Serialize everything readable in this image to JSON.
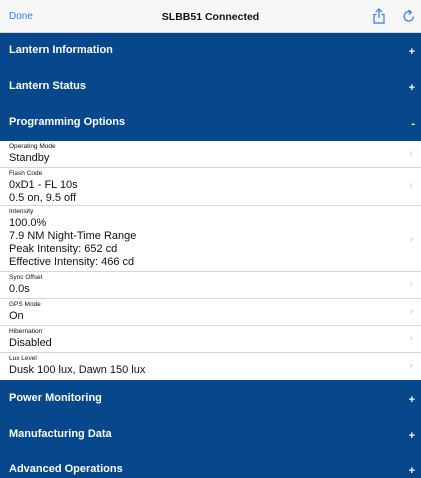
{
  "navbar": {
    "done_label": "Done",
    "title": "SLBB51 Connected",
    "share_icon": "share-icon",
    "refresh_icon": "refresh-icon"
  },
  "colors": {
    "section_bg": "#07478c",
    "link": "#2f7cf6",
    "navbar_bg": "#f7f7f7"
  },
  "sections": [
    {
      "label": "Lantern Information",
      "toggle": "+"
    },
    {
      "label": "Lantern Status",
      "toggle": "+"
    },
    {
      "label": "Programming Options",
      "toggle": "-"
    },
    {
      "label": "Power Monitoring",
      "toggle": "+"
    },
    {
      "label": "Manufacturing Data",
      "toggle": "+"
    },
    {
      "label": "Advanced Operations",
      "toggle": "+"
    }
  ],
  "options": [
    {
      "label": "Operating Mode",
      "lines": [
        "Standby"
      ]
    },
    {
      "label": "Flash Code",
      "lines": [
        "0xD1 - FL 10s",
        "0.5 on, 9.5 off"
      ]
    },
    {
      "label": "Intensity",
      "lines": [
        "100.0%",
        "7.9 NM Night-Time Range",
        "Peak Intensity: 652 cd",
        "Effective Intensity: 466 cd"
      ]
    },
    {
      "label": "Sync Offset",
      "lines": [
        "0.0s"
      ]
    },
    {
      "label": "GPS Mode",
      "lines": [
        "On"
      ]
    },
    {
      "label": "Hibernation",
      "lines": [
        "Disabled"
      ]
    },
    {
      "label": "Lux Level",
      "lines": [
        "Dusk 100 lux, Dawn 150 lux"
      ]
    }
  ],
  "chevron": "›"
}
